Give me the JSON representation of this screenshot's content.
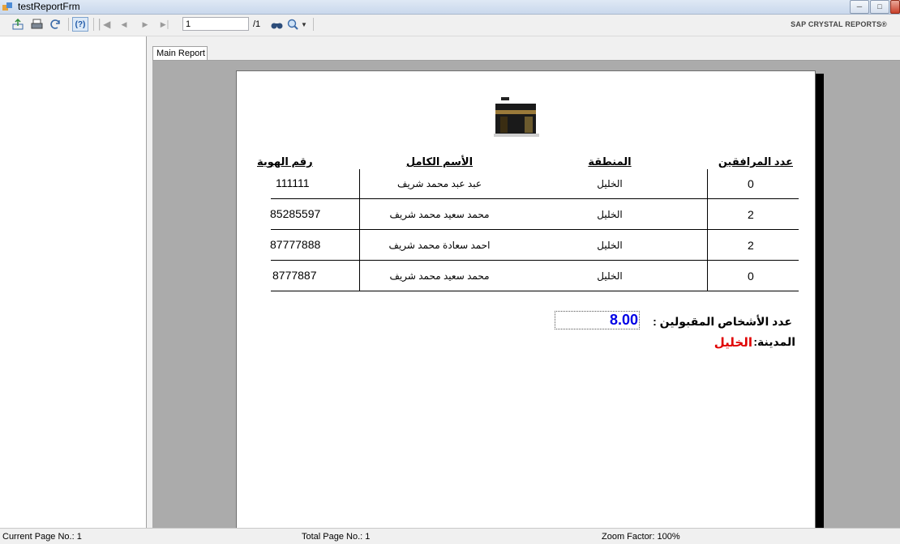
{
  "window": {
    "title": "testReportFrm"
  },
  "toolbar": {
    "page_value": "1",
    "page_total": "/1",
    "brand": "SAP CRYSTAL REPORTS®",
    "icons": [
      "export-icon",
      "print-icon",
      "refresh-icon",
      "help-icon",
      "first-page-icon",
      "previous-page-icon",
      "next-page-icon",
      "last-page-icon",
      "find-icon",
      "zoom-icon",
      "dropdown-arrow-icon"
    ]
  },
  "tab": {
    "label": "Main Report"
  },
  "report": {
    "columns": {
      "id": "رقم الهوية",
      "name": "الأسم الكامل",
      "region": "المنطقة",
      "companions": "عدد المرافقين"
    },
    "rows": [
      {
        "id": "111111",
        "name": "عبد عبد محمد شريف",
        "region": "الخليل",
        "companions": "0"
      },
      {
        "id": "85285597",
        "name": "محمد سعيد محمد شريف",
        "region": "الخليل",
        "companions": "2"
      },
      {
        "id": "87777888",
        "name": "احمد سعادة محمد شريف",
        "region": "الخليل",
        "companions": "2"
      },
      {
        "id": "8777887",
        "name": "محمد سعيد محمد شريف",
        "region": "الخليل",
        "companions": "0"
      }
    ],
    "total_label": "عدد الأشخاص المقبولين :",
    "total_value": "8.00",
    "city_label": "المدينة:",
    "city_value": "الخليل"
  },
  "status": {
    "current_page": "Current Page No.: 1",
    "total_page": "Total Page No.: 1",
    "zoom": "Zoom Factor: 100%"
  },
  "colors": {
    "total_value": "#0000e6",
    "city_value": "#e00000",
    "viewer_background": "#ababab"
  }
}
